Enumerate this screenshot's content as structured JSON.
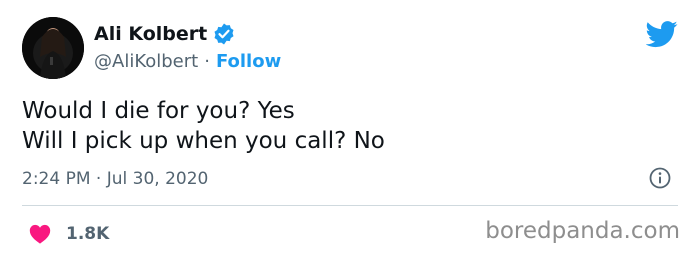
{
  "tweet": {
    "author": {
      "name": "Ali Kolbert",
      "handle": "@AliKolbert",
      "follow_label": "Follow",
      "separator": "·"
    },
    "text_lines": [
      "Would I die for you? Yes",
      "Will I pick up when you call? No"
    ],
    "timestamp": "2:24 PM · Jul 30, 2020",
    "likes": "1.8K"
  },
  "watermark": "boredpanda.com",
  "colors": {
    "accent": "#1d9bf0",
    "like": "#f91880",
    "muted": "#536471",
    "text": "#0f1419"
  },
  "icons": [
    "verified-badge-icon",
    "twitter-bird-icon",
    "info-icon",
    "heart-icon"
  ]
}
